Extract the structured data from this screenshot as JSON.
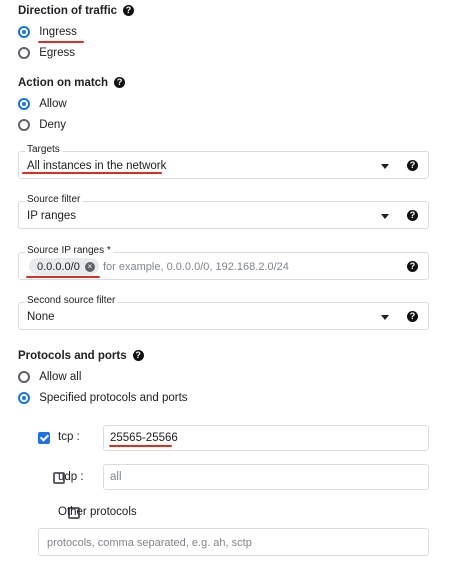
{
  "direction": {
    "heading": "Direction of traffic",
    "options": [
      {
        "label": "Ingress",
        "selected": true
      },
      {
        "label": "Egress",
        "selected": false
      }
    ]
  },
  "action": {
    "heading": "Action on match",
    "options": [
      {
        "label": "Allow",
        "selected": true
      },
      {
        "label": "Deny",
        "selected": false
      }
    ]
  },
  "targets": {
    "label": "Targets",
    "value": "All instances in the network"
  },
  "source_filter": {
    "label": "Source filter",
    "value": "IP ranges"
  },
  "source_ip_ranges": {
    "label": "Source IP ranges *",
    "chip": "0.0.0.0/0",
    "placeholder": "for example, 0.0.0.0/0, 192.168.2.0/24"
  },
  "second_source_filter": {
    "label": "Second source filter",
    "value": "None"
  },
  "protocols": {
    "heading": "Protocols and ports",
    "options": [
      {
        "label": "Allow all",
        "selected": false
      },
      {
        "label": "Specified protocols and ports",
        "selected": true
      }
    ],
    "tcp": {
      "label": "tcp :",
      "checked": true,
      "value": "25565-25566"
    },
    "udp": {
      "label": "udp :",
      "checked": false,
      "placeholder": "all"
    },
    "other": {
      "label": "Other protocols",
      "checked": false,
      "placeholder": "protocols, comma separated, e.g. ah, sctp"
    }
  },
  "help_glyph": "?",
  "remove_glyph": "×",
  "colors": {
    "accent": "#1a73e8",
    "annotation_red": "#d93025"
  }
}
